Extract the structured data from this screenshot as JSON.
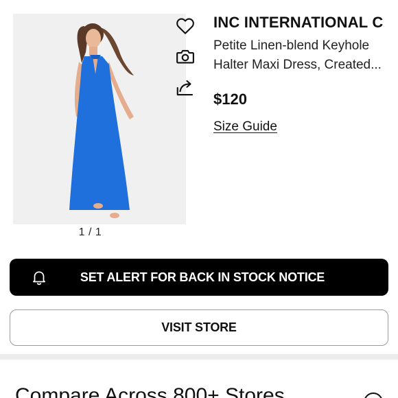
{
  "product": {
    "brand": "INC INTERNATIONAL C",
    "name": "Petite Linen-blend Keyhole Halter Maxi Dress, Created...",
    "price": "$120",
    "size_guide": "Size Guide",
    "image_counter": "1 / 1",
    "dress_color": "#1f6fdc"
  },
  "actions": {
    "alert_label": "SET ALERT FOR BACK IN STOCK NOTICE",
    "visit_label": "VISIT STORE"
  },
  "icons": [
    "heart-icon",
    "camera-icon",
    "share-icon",
    "bell-icon",
    "chevron-icon"
  ],
  "compare": {
    "heading": "Compare Across 800+ Stores"
  }
}
